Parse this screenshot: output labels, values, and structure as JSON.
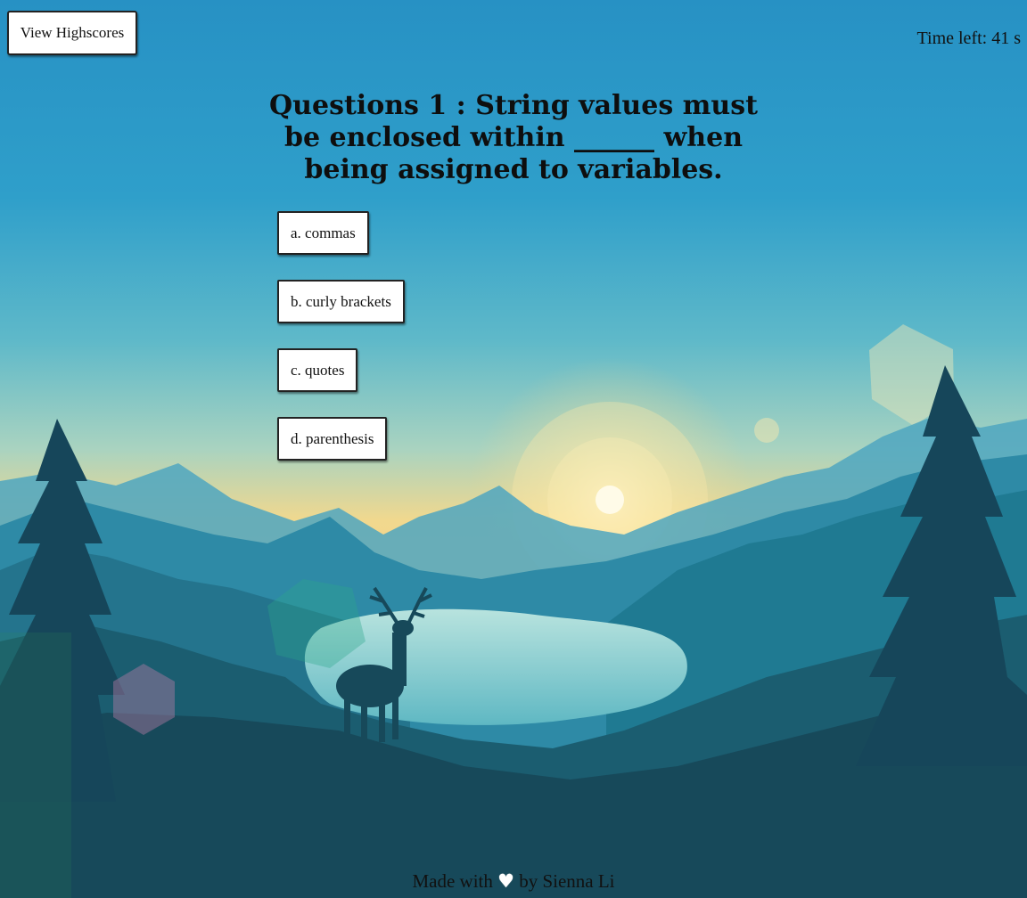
{
  "header": {
    "highscores_label": "View Highscores",
    "timer_text": "Time left: 41 s"
  },
  "quiz": {
    "question": "Questions 1 : String values must be enclosed within ______ when being assigned to variables.",
    "answers": [
      "a. commas",
      "b. curly brackets",
      "c. quotes",
      "d. parenthesis"
    ]
  },
  "footer": {
    "prefix": "Made with",
    "heart_icon": "heart-icon",
    "suffix": "by Sienna Li"
  },
  "colors": {
    "sky_top": "#2a93c4",
    "sky_horizon": "#f4d58a",
    "mountain_dark": "#17495a",
    "lake": "#6cc3c9",
    "sun": "#fff3c4"
  }
}
